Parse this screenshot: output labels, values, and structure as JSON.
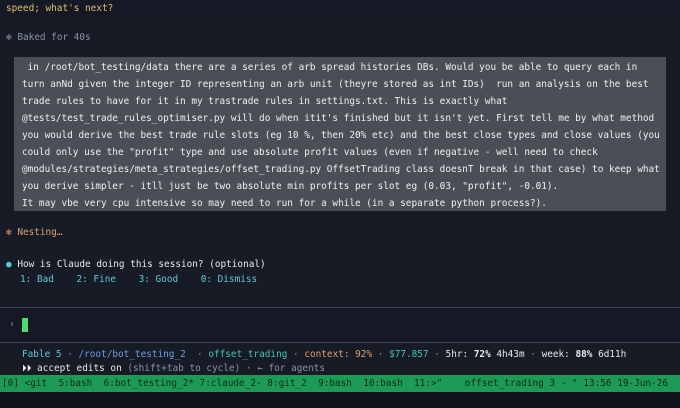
{
  "top": {
    "line": "speed; what's next?"
  },
  "baked": {
    "glyph": "✻",
    "text": "Baked for 40s"
  },
  "prompt": {
    "lines": [
      " in /root/bot_testing/data there are a series of arb spread histories DBs. Would you be able to query each in",
      "turn anNd given the integer ID representing an arb unit (theyre stored as int IDs)  run an analysis on the best",
      "trade rules to have for it in my trastrade rules in settings.txt. This is exactly what",
      "@tests/test_trade_rules_optimiser.py will do when itit's finished but it isn't yet. First tell me by what method",
      "you would derive the best trade rule slots (eg 10 %, then 20% etc) and the best close types and close values (you",
      "could only use the \"profit\" type and use absolute profit values (even if negative - well need to check",
      "@modules/strategies/meta_strategies/offset_trading.py OffsetTrading class doesnT break in that case) to keep what",
      "you derive simpler - itll just be two absolute min profits per slot eg (0.03, \"profit\", -0.01).",
      "",
      "It may vbe very cpu intensive so may need to run for a while (in a separate python process?)."
    ]
  },
  "nesting": {
    "glyph": "✻",
    "text": "Nesting…"
  },
  "feedback": {
    "bullet": "●",
    "question": "How is Claude doing this session? (optional)",
    "options": [
      {
        "key": "1:",
        "label": "Bad"
      },
      {
        "key": "2:",
        "label": "Fine"
      },
      {
        "key": "3:",
        "label": "Good"
      },
      {
        "key": "0:",
        "label": "Dismiss"
      }
    ]
  },
  "input": {
    "prompt_char": "›"
  },
  "statusline": {
    "model": "Fable 5",
    "sep": "·",
    "path": "/root/bot_testing_2",
    "branch": "offset_trading",
    "context_label": "context:",
    "context_value": "92%",
    "cost": "$77.857",
    "hr5_label": "5hr:",
    "hr5_value": "72%",
    "hr5_time": "4h43m",
    "week_label": "week:",
    "week_value": "88%",
    "week_time": "6d11h"
  },
  "mode": {
    "icon": "⏵⏵",
    "text": "accept edits on",
    "hint": "(shift+tab to cycle)",
    "sep": "·",
    "agents": "← for agents"
  },
  "tmux": {
    "windows": "[0] <git  5:bash  6:bot_testing_2* 7:claude_2- 8:git_2  9:bash  10:bash  11:>\"",
    "right": "offset_trading 3 - \" 13:56 19-Jun-26"
  },
  "colors": {
    "background": "#161b26",
    "accent_cyan": "#5fc6d8",
    "tmux_green": "#1e9a57",
    "cursor_green": "#4ddb6e"
  }
}
